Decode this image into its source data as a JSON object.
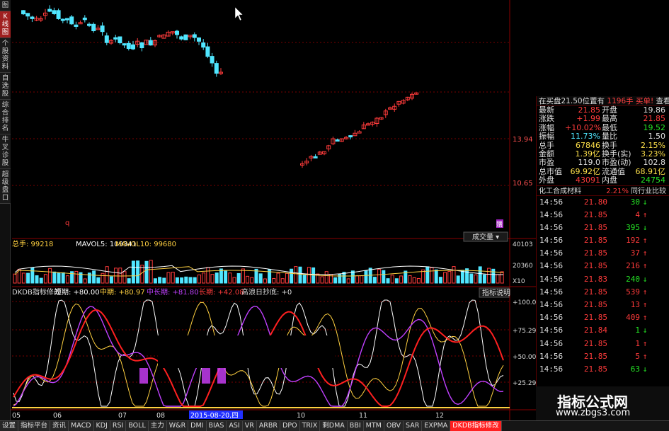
{
  "left_toolbar": [
    "图",
    "K线图",
    "个股资料",
    "自选股",
    "综合排名",
    "牛叉诊股",
    "超级盘口"
  ],
  "main_chart": {
    "price_labels": [
      "13.94",
      "10.65"
    ],
    "marker_q": "q",
    "marker_purple": "購"
  },
  "volume_panel": {
    "total_label": "总手: 99218",
    "mavol5": "MAVOL5: 109341",
    "mavol10": "MAVOL10: 99680",
    "dropdown_label": "成交量",
    "scale": [
      "40103",
      "20360",
      "X10"
    ]
  },
  "indicator_panel": {
    "name": "DKDB指标修改",
    "short": "短期: +80.00",
    "mid": "中期: +80.97",
    "midlong": "中长期: +81.80",
    "long": "长期: +42.08",
    "bottom_signal": "高浪日抄底: +0",
    "help_button": "指标说明",
    "scale": [
      "+100.0",
      "+75.29",
      "+50.00",
      "+25.29"
    ]
  },
  "date_axis": [
    "05",
    "06",
    "07",
    "08",
    "2015-08-20,四",
    "10",
    "11",
    "12"
  ],
  "quote_header": {
    "text": "在买盘21.50位置有",
    "qty": "1196手",
    "action": "买单!",
    "detail": "查看详细"
  },
  "quote_rows": [
    {
      "l1": "最新",
      "v1": "21.85",
      "c1": "red",
      "l2": "开盘",
      "v2": "19.86",
      "c2": "wht"
    },
    {
      "l1": "涨跌",
      "v1": "+1.99",
      "c1": "red",
      "l2": "最高",
      "v2": "21.85",
      "c2": "red"
    },
    {
      "l1": "涨幅",
      "v1": "+10.02%",
      "c1": "red",
      "l2": "最低",
      "v2": "19.52",
      "c2": "grn"
    },
    {
      "l1": "振幅",
      "v1": "11.73%",
      "c1": "cyn",
      "l2": "量比",
      "v2": "1.50",
      "c2": "wht"
    },
    {
      "l1": "总手",
      "v1": "67846",
      "c1": "yel",
      "l2": "换手",
      "v2": "2.15%",
      "c2": "yel"
    },
    {
      "l1": "金额",
      "v1": "1.39亿",
      "c1": "yel",
      "l2": "换手(实)",
      "v2": "3.23%",
      "c2": "yel"
    },
    {
      "l1": "市盈",
      "v1": "119.0",
      "c1": "wht",
      "l2": "市盈(动)",
      "v2": "102.8",
      "c2": "wht"
    },
    {
      "l1": "总市值",
      "v1": "69.92亿",
      "c1": "yel",
      "l2": "流通值",
      "v2": "68.91亿",
      "c2": "yel"
    },
    {
      "l1": "外盘",
      "v1": "43091",
      "c1": "red",
      "l2": "内盘",
      "v2": "24754",
      "c2": "grn"
    }
  ],
  "sector": {
    "name": "化工合成材料",
    "pct": "2.21%",
    "compare": "同行业比较"
  },
  "ticks": [
    {
      "time": "14:56",
      "price": "21.80",
      "vol": "30",
      "dir": "down"
    },
    {
      "time": "14:56",
      "price": "21.85",
      "vol": "4",
      "dir": "up"
    },
    {
      "time": "14:56",
      "price": "21.85",
      "vol": "395",
      "dir": "down"
    },
    {
      "time": "14:56",
      "price": "21.85",
      "vol": "192",
      "dir": "up"
    },
    {
      "time": "14:56",
      "price": "21.85",
      "vol": "37",
      "dir": "up"
    },
    {
      "time": "14:56",
      "price": "21.85",
      "vol": "216",
      "dir": "up"
    },
    {
      "time": "14:56",
      "price": "21.83",
      "vol": "240",
      "dir": "down"
    },
    {
      "time": "14:56",
      "price": "21.85",
      "vol": "539",
      "dir": "up"
    },
    {
      "time": "14:56",
      "price": "21.85",
      "vol": "13",
      "dir": "up"
    },
    {
      "time": "14:56",
      "price": "21.85",
      "vol": "409",
      "dir": "up"
    },
    {
      "time": "14:56",
      "price": "21.84",
      "vol": "1",
      "dir": "down"
    },
    {
      "time": "14:56",
      "price": "21.85",
      "vol": "1",
      "dir": "up"
    },
    {
      "time": "14:56",
      "price": "21.85",
      "vol": "5",
      "dir": "up"
    },
    {
      "time": "14:56",
      "price": "21.85",
      "vol": "63",
      "dir": "down"
    }
  ],
  "bottom_tabs": [
    "设置",
    "指标平台",
    "资讯",
    "MACD",
    "KDJ",
    "RSI",
    "BOLL",
    "主力",
    "W&R",
    "DMI",
    "BIAS",
    "ASI",
    "VR",
    "ARBR",
    "DPO",
    "TRIX",
    "剩DMA",
    "BBI",
    "MTM",
    "OBV",
    "SAR",
    "EXPMA",
    "DKDB指标修改"
  ],
  "watermark": {
    "title": "指标公式网",
    "url": "www.zbgs3.com"
  },
  "colors": {
    "up": "#ff3b3b",
    "down": "#50e6ff",
    "grid": "#7a0000",
    "volume_up": "#ff3b3b",
    "volume_down": "#50e6ff"
  }
}
